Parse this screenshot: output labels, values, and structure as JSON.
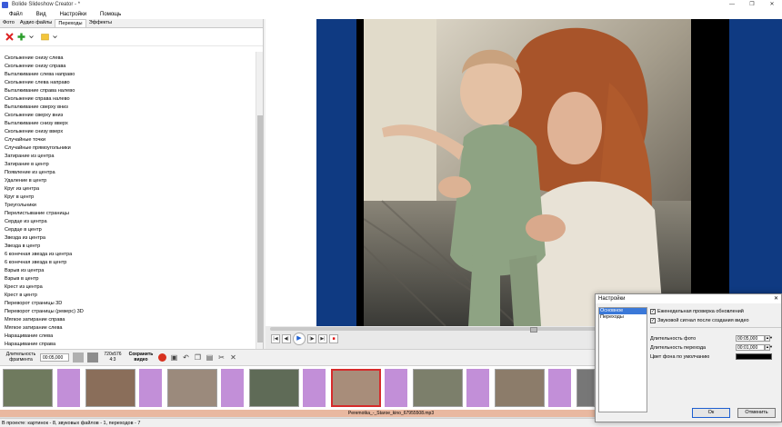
{
  "window": {
    "title": "Bolide Slideshow Creator - *",
    "controls": [
      "—",
      "❐",
      "✕"
    ]
  },
  "menu": [
    "Файл",
    "Вид",
    "Настройки",
    "Помощь"
  ],
  "tabs": [
    "Фото",
    "Аудио файлы",
    "Переходы",
    "Эффекты"
  ],
  "transitions": [
    "Скольжение снизу слева",
    "Скольжение снизу справа",
    "Выталкивание слева направо",
    "Скольжение слева направо",
    "Выталкивание справа налево",
    "Скольжение справа налево",
    "Выталкивание сверху вниз",
    "Скольжение сверху вниз",
    "Выталкивание снизу вверх",
    "Скольжение снизу вверх",
    "Случайные точки",
    "Случайные прямоугольники",
    "Затирание из центра",
    "Затирание в центр",
    "Появление из центра",
    "Удаление в центр",
    "Круг из центра",
    "Круг в центр",
    "Треугольники",
    "Перелистывание страницы",
    "Сердце из центра",
    "Сердце в центр",
    "Звезда из центра",
    "Звезда в центр",
    "6 конечная звезда из центра",
    "6 конечная звезда в центр",
    "Взрыв из центра",
    "Взрыв в центр",
    "Крест из центра",
    "Крест в центр",
    "Переворот страницы 3D",
    "Переворот страницы (реверс) 3D",
    "Мягкое затирание справа",
    "Мягкое затирание слева",
    "Наращивание слева",
    "Наращивание справа"
  ],
  "toolbar": {
    "fragment_label": "Длительность фрагмента",
    "fragment_value": "00:05,000",
    "resolution": "720x576",
    "aspect": "4:3",
    "save_label": "Сохранить видео"
  },
  "playback": {
    "position": 0.52
  },
  "timeline": {
    "audio_label": "Peremotka_-_Staroe_kino_67955508.mp3"
  },
  "status": "В проекте: картинок - 8, звуковых файлов - 1, переходов - 7",
  "dialog": {
    "title": "Настройки",
    "close": "✕",
    "nav": [
      "Основное",
      "Переходы"
    ],
    "chk_updates": "Еженедельная проверка обновлений",
    "chk_sound": "Звуковой сигнал после создания видео",
    "photo_dur_label": "Длительность фото",
    "photo_dur_value": "00:05,000",
    "trans_dur_label": "Длительность перехода",
    "trans_dur_value": "00:01,000",
    "bg_label": "Цвет фона по умолчанию",
    "ok": "Ок",
    "cancel": "Отменить",
    "bg_color": "#000000"
  },
  "colors": {
    "letterbox": "#0f3a82",
    "accent": "#1e5fd0",
    "record": "#d73220",
    "selected": "#d62b2b"
  }
}
